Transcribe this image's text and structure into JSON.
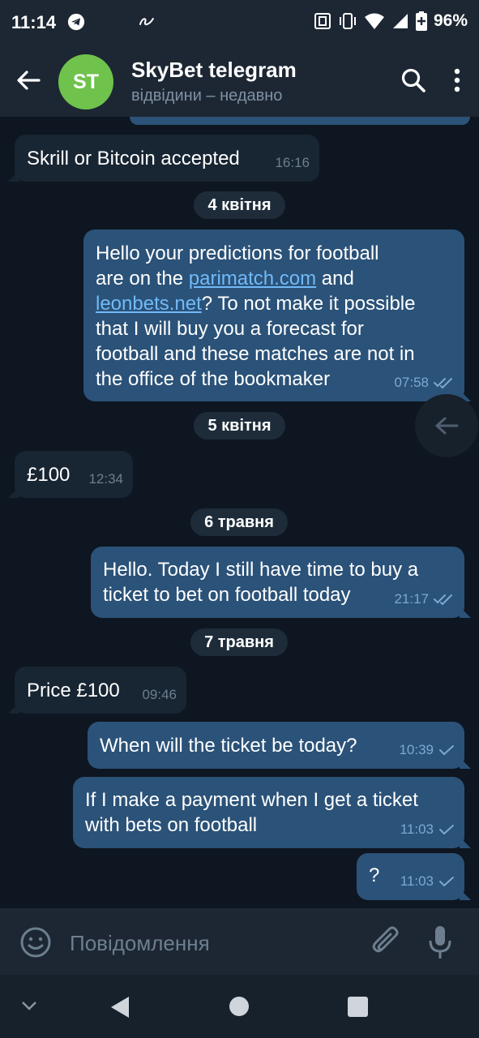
{
  "status_bar": {
    "time": "11:14",
    "battery": "96%",
    "icons": [
      "telegram-icon",
      "app-icon",
      "nfc-icon",
      "vibrate-icon",
      "wifi-icon",
      "signal-icon",
      "battery-icon"
    ]
  },
  "header": {
    "avatar_initials": "ST",
    "title": "SkyBet telegram",
    "subtitle": "відвідини – недавно"
  },
  "colors": {
    "background": "#0e1621",
    "bar": "#1d2733",
    "incoming_bubble": "#182533",
    "outgoing_bubble": "#2b5278",
    "avatar": "#6fc24c",
    "link": "#71baf9",
    "check": "#7ea8d3"
  },
  "messages": {
    "m1": {
      "lines": [
        "Skrill or Bitcoin accepted"
      ],
      "time": "16:16"
    },
    "d1": "4 квітня",
    "m2": {
      "l1": "Hello your predictions for football",
      "l2a": "are on the ",
      "link1": "parimatch.com",
      "l2b": " and",
      "link2": "leonbets.net",
      "l3b": "? To not make it possible",
      "l4": "that I will buy you a forecast for",
      "l5": "football and these matches are not in",
      "l6": "the office of the bookmaker",
      "time": "07:58"
    },
    "d2": "5 квітня",
    "m3": {
      "text": "£100",
      "time": "12:34"
    },
    "d3": "6 травня",
    "m4": {
      "l1": "Hello. Today I still have time to buy a",
      "l2": "ticket to bet on football today",
      "time": "21:17"
    },
    "d4": "7 травня",
    "m5": {
      "text": "Price £100",
      "time": "09:46"
    },
    "m6": {
      "text": "When will the ticket be today?",
      "time": "10:39"
    },
    "m7": {
      "l1": "If I make a payment when I get a ticket",
      "l2": "with bets on football",
      "time": "11:03"
    },
    "m8": {
      "text": "?",
      "time": "11:03"
    }
  },
  "input": {
    "placeholder": "Повідомлення"
  }
}
